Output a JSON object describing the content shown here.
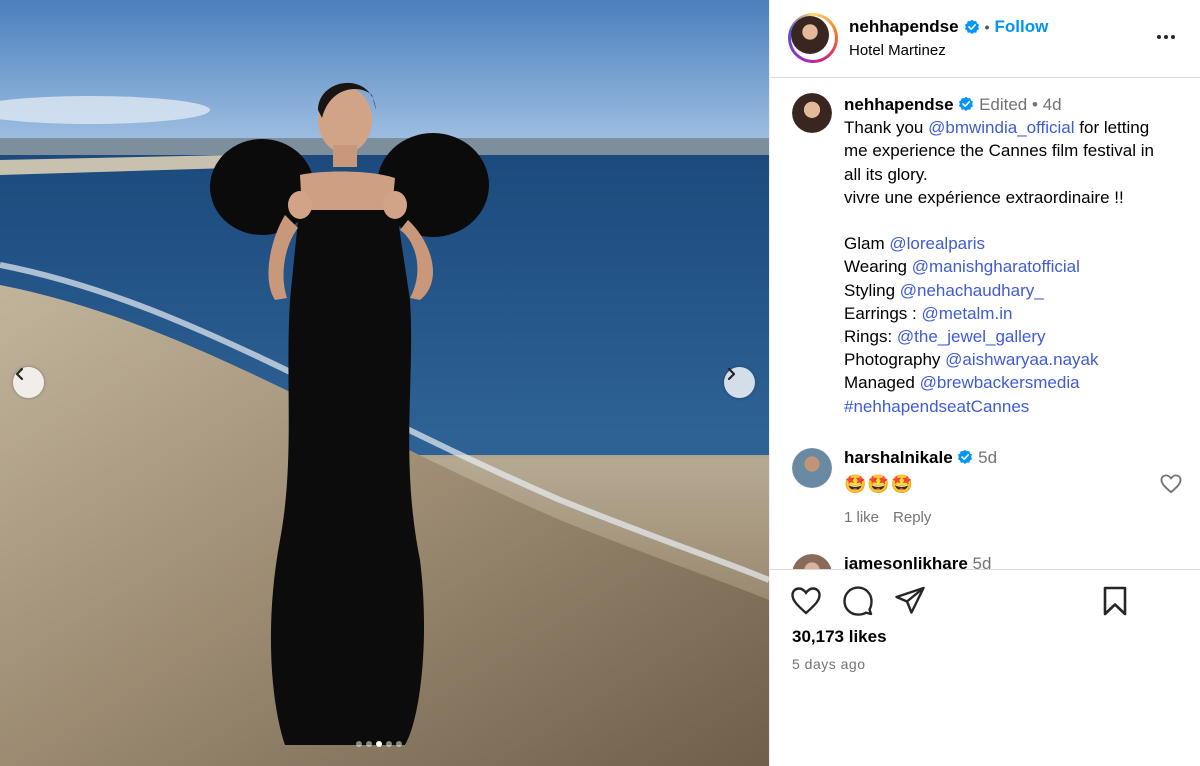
{
  "post": {
    "carousel": {
      "total_images": 5,
      "active_index": 2
    },
    "header": {
      "username": "nehhapendse",
      "separator": "•",
      "follow_label": "Follow",
      "location": "Hotel Martinez"
    },
    "caption": {
      "username": "nehhapendse",
      "edited_label": "Edited",
      "separator": "•",
      "time": "4d",
      "intro_text": "Thank you",
      "intro_mention": "@bmwindia_official",
      "intro_rest_1": "for letting",
      "line2": "me experience the Cannes film festival in",
      "line3": "all its glory.",
      "line4": "vivre une expérience extraordinaire !!",
      "credits": [
        {
          "label": "Glam",
          "handle": "@lorealparis"
        },
        {
          "label": "Wearing",
          "handle": "@manishgharatofficial"
        },
        {
          "label": "Styling",
          "handle": "@nehachaudhary_"
        },
        {
          "label": "Earrings :",
          "handle": "@metalm.in"
        },
        {
          "label": "Rings:",
          "handle": "@the_jewel_gallery"
        },
        {
          "label": "Photography",
          "handle": "@aishwaryaa.nayak"
        },
        {
          "label": "Managed",
          "handle": "@brewbackersmedia"
        }
      ],
      "hashtag": "#nehhapendseatCannes"
    },
    "comments": [
      {
        "username": "harshalnikale",
        "time": "5d",
        "text": "🤩🤩🤩",
        "likes": "1 like",
        "reply_label": "Reply"
      },
      {
        "username": "jamesonlikhare",
        "time": "5d"
      }
    ],
    "likes_count": "30,173 likes",
    "posted_ago": "5 days ago",
    "colors": {
      "link": "#3f5bd5",
      "follow": "#0095f6",
      "verified": "#0095f6",
      "muted": "#737373"
    }
  }
}
